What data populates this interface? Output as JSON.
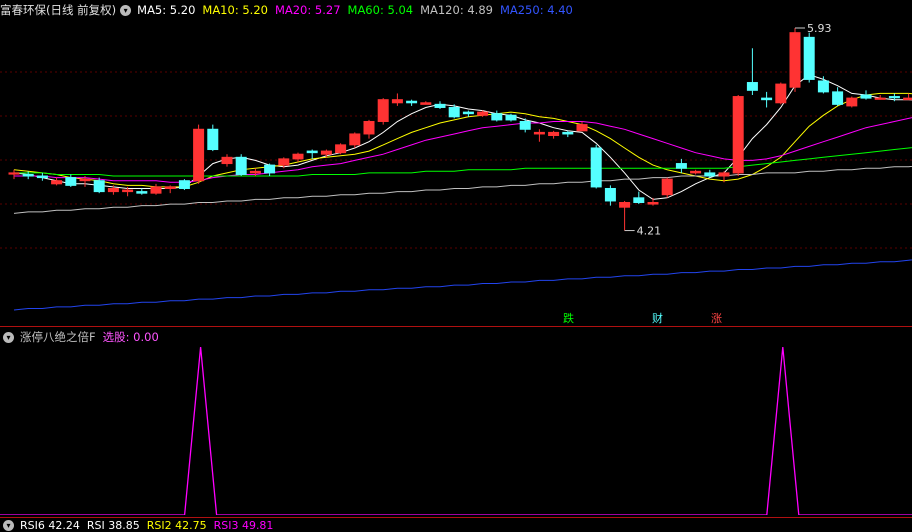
{
  "main_panel": {
    "stock_name": "富春环保",
    "period": "(日线 前复权)",
    "indicators": [
      {
        "label": "MA5: 5.20",
        "color": "#ffffff"
      },
      {
        "label": "MA10: 5.20",
        "color": "#ffff00"
      },
      {
        "label": "MA20: 5.27",
        "color": "#ff00ff"
      },
      {
        "label": "MA60: 5.04",
        "color": "#00ff00"
      },
      {
        "label": "MA120: 4.89",
        "color": "#c0c0c0"
      },
      {
        "label": "MA250: 4.40",
        "color": "#3355ff"
      }
    ],
    "high_label": "5.93",
    "low_label": "4.21",
    "markers": [
      {
        "text": "跌",
        "color": "#00ff00"
      },
      {
        "text": "财",
        "color": "#55ffff"
      },
      {
        "text": "涨",
        "color": "#ff4444"
      }
    ]
  },
  "sub_panel": {
    "indicator_name": "涨停八绝之倍F",
    "value_label": "选股: 0.00",
    "name_color": "#c0c0c0",
    "value_color": "#ff55ff",
    "signal_color": "#ff00ff"
  },
  "bottom_panel": {
    "labels": [
      {
        "text": "RSI6 42.24",
        "color": "#ffffff"
      },
      {
        "text": "RSI 38.85",
        "color": "#ffffff"
      },
      {
        "text": "RSI2 42.75",
        "color": "#ffff00"
      },
      {
        "text": "RSI3 49.81",
        "color": "#ff00ff"
      }
    ]
  },
  "chart_data": {
    "type": "candlestick",
    "candles": [
      [
        5.0,
        5.02,
        4.96,
        5.0,
        "u"
      ],
      [
        4.99,
        5.01,
        4.96,
        4.98,
        "d"
      ],
      [
        4.98,
        5.0,
        4.95,
        4.97,
        "d"
      ],
      [
        4.95,
        4.97,
        4.92,
        4.93,
        "u"
      ],
      [
        4.97,
        4.99,
        4.91,
        4.92,
        "d"
      ],
      [
        4.96,
        4.98,
        4.91,
        4.95,
        "u"
      ],
      [
        4.95,
        4.97,
        4.87,
        4.88,
        "d"
      ],
      [
        4.88,
        4.92,
        4.86,
        4.9,
        "u"
      ],
      [
        4.88,
        4.91,
        4.85,
        4.89,
        "u"
      ],
      [
        4.88,
        4.9,
        4.86,
        4.87,
        "d"
      ],
      [
        4.87,
        4.93,
        4.86,
        4.91,
        "u"
      ],
      [
        4.9,
        4.92,
        4.87,
        4.91,
        "u"
      ],
      [
        4.9,
        4.96,
        4.89,
        4.95,
        "d"
      ],
      [
        4.95,
        5.31,
        4.93,
        5.28,
        "u"
      ],
      [
        5.28,
        5.31,
        5.14,
        5.15,
        "d"
      ],
      [
        5.1,
        5.12,
        5.04,
        5.06,
        "u"
      ],
      [
        5.1,
        5.12,
        4.98,
        4.99,
        "d"
      ],
      [
        5.0,
        5.03,
        4.98,
        5.01,
        "u"
      ],
      [
        5.0,
        5.06,
        4.98,
        5.05,
        "d"
      ],
      [
        5.05,
        5.1,
        5.03,
        5.09,
        "u"
      ],
      [
        5.09,
        5.13,
        5.07,
        5.12,
        "u"
      ],
      [
        5.13,
        5.15,
        5.09,
        5.14,
        "d"
      ],
      [
        5.12,
        5.15,
        5.1,
        5.14,
        "u"
      ],
      [
        5.13,
        5.19,
        5.12,
        5.18,
        "u"
      ],
      [
        5.18,
        5.26,
        5.16,
        5.25,
        "u"
      ],
      [
        5.25,
        5.34,
        5.22,
        5.33,
        "u"
      ],
      [
        5.33,
        5.48,
        5.31,
        5.47,
        "u"
      ],
      [
        5.47,
        5.51,
        5.43,
        5.45,
        "u"
      ],
      [
        5.45,
        5.47,
        5.43,
        5.46,
        "d"
      ],
      [
        5.45,
        5.46,
        5.44,
        5.44,
        "u"
      ],
      [
        5.44,
        5.46,
        5.41,
        5.42,
        "d"
      ],
      [
        5.42,
        5.44,
        5.35,
        5.36,
        "d"
      ],
      [
        5.38,
        5.4,
        5.36,
        5.39,
        "d"
      ],
      [
        5.39,
        5.4,
        5.36,
        5.37,
        "u"
      ],
      [
        5.38,
        5.4,
        5.33,
        5.34,
        "d"
      ],
      [
        5.34,
        5.38,
        5.33,
        5.37,
        "d"
      ],
      [
        5.33,
        5.35,
        5.26,
        5.28,
        "d"
      ],
      [
        5.26,
        5.28,
        5.2,
        5.25,
        "u"
      ],
      [
        5.24,
        5.27,
        5.22,
        5.26,
        "u"
      ],
      [
        5.25,
        5.27,
        5.23,
        5.26,
        "d"
      ],
      [
        5.31,
        5.33,
        5.27,
        5.27,
        "u"
      ],
      [
        5.16,
        5.18,
        4.9,
        4.91,
        "d"
      ],
      [
        4.9,
        4.92,
        4.79,
        4.82,
        "d"
      ],
      [
        4.81,
        4.82,
        4.63,
        4.78,
        "u"
      ],
      [
        4.81,
        4.88,
        4.8,
        4.84,
        "d"
      ],
      [
        4.81,
        4.84,
        4.79,
        4.8,
        "u"
      ],
      [
        4.86,
        4.97,
        4.84,
        4.96,
        "u"
      ],
      [
        5.06,
        5.09,
        5.0,
        5.03,
        "d"
      ],
      [
        5.0,
        5.02,
        4.99,
        5.01,
        "u"
      ],
      [
        5.0,
        5.02,
        4.97,
        4.98,
        "d"
      ],
      [
        4.98,
        5.01,
        4.94,
        5.0,
        "u"
      ],
      [
        5.0,
        5.5,
        4.98,
        5.49,
        "u"
      ],
      [
        5.53,
        5.8,
        5.5,
        5.58,
        "d"
      ],
      [
        5.48,
        5.52,
        5.42,
        5.47,
        "d"
      ],
      [
        5.45,
        5.58,
        5.44,
        5.57,
        "u"
      ],
      [
        5.55,
        5.93,
        5.52,
        5.9,
        "u"
      ],
      [
        5.87,
        5.9,
        5.58,
        5.6,
        "d"
      ],
      [
        5.59,
        5.62,
        5.51,
        5.52,
        "d"
      ],
      [
        5.52,
        5.55,
        5.43,
        5.44,
        "d"
      ],
      [
        5.43,
        5.49,
        5.42,
        5.48,
        "u"
      ],
      [
        5.5,
        5.53,
        5.47,
        5.48,
        "d"
      ],
      [
        5.48,
        5.5,
        5.47,
        5.48,
        "u"
      ],
      [
        5.49,
        5.51,
        5.46,
        5.49,
        "d"
      ],
      [
        5.48,
        5.51,
        5.47,
        5.47,
        "u"
      ],
      [
        5.5,
        5.53,
        5.46,
        5.46,
        "d"
      ]
    ],
    "ma_lines": {
      "MA5": [
        5.0,
        4.99,
        4.97,
        4.95,
        4.93,
        4.93,
        4.92,
        4.91,
        4.9,
        4.9,
        4.9,
        4.9,
        4.91,
        4.98,
        5.06,
        5.09,
        5.1,
        5.08,
        5.05,
        5.04,
        5.05,
        5.08,
        5.11,
        5.13,
        5.16,
        5.2,
        5.26,
        5.33,
        5.38,
        5.42,
        5.44,
        5.43,
        5.41,
        5.4,
        5.38,
        5.37,
        5.34,
        5.32,
        5.29,
        5.27,
        5.26,
        5.19,
        5.1,
        5.0,
        4.89,
        4.83,
        4.84,
        4.88,
        4.93,
        4.97,
        5.0,
        5.1,
        5.22,
        5.31,
        5.42,
        5.56,
        5.63,
        5.6,
        5.56,
        5.51,
        5.5,
        5.48,
        5.47,
        5.47,
        5.46
      ],
      "MA10": [
        5.02,
        5.01,
        5.0,
        4.99,
        4.97,
        4.96,
        4.95,
        4.93,
        4.92,
        4.92,
        4.91,
        4.91,
        4.91,
        4.94,
        4.98,
        5.0,
        5.02,
        5.03,
        5.04,
        5.05,
        5.07,
        5.09,
        5.1,
        5.11,
        5.12,
        5.14,
        5.18,
        5.22,
        5.26,
        5.29,
        5.32,
        5.34,
        5.36,
        5.37,
        5.38,
        5.39,
        5.38,
        5.36,
        5.35,
        5.33,
        5.31,
        5.27,
        5.22,
        5.16,
        5.1,
        5.05,
        5.02,
        5.0,
        4.98,
        4.96,
        4.95,
        4.96,
        4.99,
        5.04,
        5.1,
        5.2,
        5.3,
        5.37,
        5.43,
        5.47,
        5.5,
        5.51,
        5.51,
        5.51,
        5.5
      ],
      "MA20": [
        4.98,
        4.98,
        4.98,
        4.97,
        4.97,
        4.97,
        4.96,
        4.95,
        4.95,
        4.95,
        4.95,
        4.94,
        4.94,
        4.95,
        4.97,
        4.98,
        4.99,
        4.99,
        5.0,
        5.01,
        5.02,
        5.04,
        5.05,
        5.06,
        5.08,
        5.1,
        5.12,
        5.15,
        5.18,
        5.21,
        5.23,
        5.25,
        5.27,
        5.29,
        5.3,
        5.31,
        5.32,
        5.32,
        5.33,
        5.33,
        5.33,
        5.32,
        5.3,
        5.28,
        5.25,
        5.22,
        5.19,
        5.16,
        5.13,
        5.11,
        5.09,
        5.08,
        5.08,
        5.09,
        5.11,
        5.14,
        5.17,
        5.2,
        5.23,
        5.26,
        5.29,
        5.31,
        5.33,
        5.35,
        5.37
      ],
      "MA60": [
        5.0,
        5.0,
        5.0,
        4.99,
        4.99,
        4.99,
        4.99,
        4.98,
        4.98,
        4.98,
        4.98,
        4.98,
        4.98,
        4.98,
        4.98,
        4.98,
        4.98,
        4.98,
        4.98,
        4.98,
        4.98,
        4.99,
        4.99,
        4.99,
        4.99,
        5.0,
        5.0,
        5.0,
        5.0,
        5.01,
        5.01,
        5.01,
        5.02,
        5.02,
        5.02,
        5.02,
        5.03,
        5.03,
        5.03,
        5.03,
        5.03,
        5.03,
        5.03,
        5.03,
        5.03,
        5.03,
        5.03,
        5.03,
        5.03,
        5.03,
        5.03,
        5.04,
        5.05,
        5.06,
        5.07,
        5.08,
        5.09,
        5.1,
        5.11,
        5.12,
        5.13,
        5.14,
        5.15,
        5.16,
        5.17
      ],
      "MA120": [
        4.74,
        4.75,
        4.75,
        4.76,
        4.76,
        4.77,
        4.77,
        4.78,
        4.78,
        4.79,
        4.79,
        4.8,
        4.8,
        4.81,
        4.81,
        4.82,
        4.82,
        4.83,
        4.83,
        4.84,
        4.84,
        4.85,
        4.85,
        4.86,
        4.86,
        4.87,
        4.87,
        4.88,
        4.88,
        4.89,
        4.89,
        4.9,
        4.9,
        4.91,
        4.91,
        4.92,
        4.92,
        4.93,
        4.93,
        4.94,
        4.94,
        4.95,
        4.95,
        4.96,
        4.96,
        4.97,
        4.97,
        4.98,
        4.98,
        4.98,
        4.98,
        4.99,
        4.99,
        5.0,
        5.0,
        5.0,
        5.01,
        5.01,
        5.02,
        5.02,
        5.03,
        5.03,
        5.04,
        5.04,
        5.05
      ],
      "MA250": [
        4.12,
        4.13,
        4.13,
        4.14,
        4.14,
        4.15,
        4.15,
        4.16,
        4.16,
        4.17,
        4.17,
        4.18,
        4.18,
        4.19,
        4.19,
        4.2,
        4.2,
        4.21,
        4.21,
        4.22,
        4.22,
        4.23,
        4.23,
        4.24,
        4.24,
        4.25,
        4.25,
        4.26,
        4.26,
        4.27,
        4.27,
        4.28,
        4.28,
        4.29,
        4.29,
        4.3,
        4.3,
        4.31,
        4.31,
        4.32,
        4.32,
        4.33,
        4.33,
        4.34,
        4.34,
        4.35,
        4.35,
        4.36,
        4.36,
        4.37,
        4.37,
        4.38,
        4.38,
        4.39,
        4.39,
        4.4,
        4.4,
        4.41,
        4.41,
        4.42,
        4.42,
        4.43,
        4.43,
        4.44,
        4.45
      ]
    },
    "signal_spikes": [
      13,
      54
    ],
    "signal_value": "0.00"
  }
}
